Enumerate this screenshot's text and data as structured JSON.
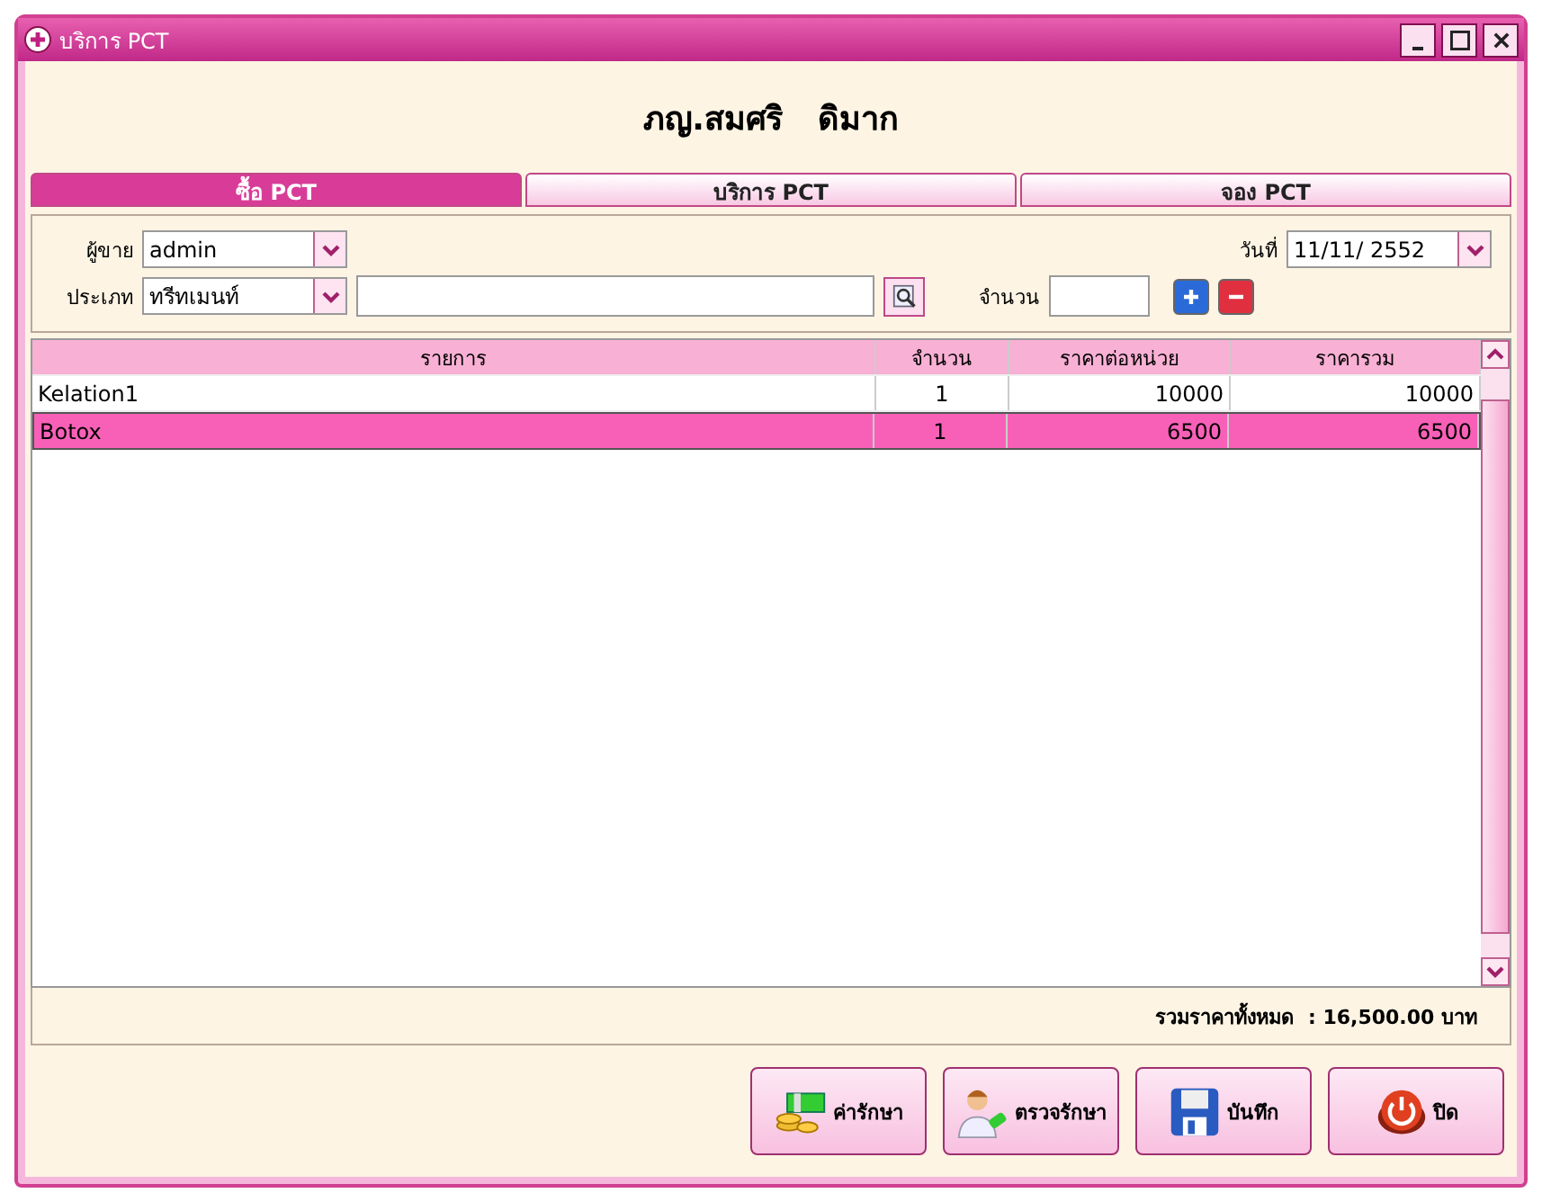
{
  "window": {
    "title": "บริการ PCT"
  },
  "patient_name": "ภญ.สมศริ   ดิมาก",
  "tabs": [
    {
      "label": "ซื้อ PCT",
      "selected": true
    },
    {
      "label": "บริการ PCT",
      "selected": false
    },
    {
      "label": "จอง PCT",
      "selected": false
    }
  ],
  "form": {
    "seller": {
      "label": "ผู้ขาย",
      "value": "admin"
    },
    "type": {
      "label": "ประเภท",
      "value": "ทรีทเมนท์"
    },
    "date": {
      "label": "วันที่",
      "value": "11/11/ 2552"
    },
    "quantity": {
      "label": "จำนวน"
    }
  },
  "table": {
    "columns": [
      "รายการ",
      "จำนวน",
      "ราคาต่อหน่วย",
      "ราคารวม"
    ],
    "rows": [
      {
        "cells": [
          "Kelation1",
          "1",
          "10000",
          "10000"
        ],
        "selected": false
      },
      {
        "cells": [
          "Botox",
          "1",
          "6500",
          "6500"
        ],
        "selected": true
      }
    ]
  },
  "total": {
    "label": "รวมราคาทั้งหมด",
    "value": ": 16,500.00 บาท"
  },
  "buttons": [
    {
      "kind": "money",
      "label": "ค่ารักษา"
    },
    {
      "kind": "doctor",
      "label": "ตรวจรักษา"
    },
    {
      "kind": "save",
      "label": "บันทึก"
    },
    {
      "kind": "power",
      "label": "ปิด"
    }
  ]
}
